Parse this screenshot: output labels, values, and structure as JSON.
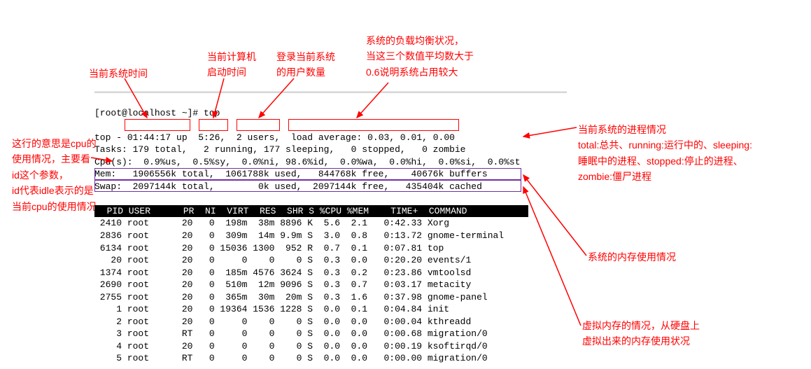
{
  "annotations": {
    "time": "当前系统时间",
    "uptime": "当前计算机\n启动时间",
    "users": "登录当前系统\n的用户数量",
    "load": "系统的负载均衡状况，\n当这三个数值平均数大于\n0.6说明系统占用较大",
    "cpu": "这行的意思是cpu的\n使用情况，主要看\nid这个参数，\nid代表idle表示的是\n当前cpu的使用情况",
    "tasks": "当前系统的进程情况\ntotal:总共、running:运行中的、sleeping:\n睡眠中的进程、stopped:停止的进程、\nzombie:僵尸进程",
    "mem": "系统的内存使用情况",
    "swap": "虚拟内存的情况，从硬盘上\n虚拟出来的内存使用状况"
  },
  "prompt": "[root@localhost ~]# top",
  "summary": {
    "line1_pre": "top - ",
    "time": "01:44:17 up",
    "uptime": "5:26",
    "users": "2 users",
    "load": "load average: 0.03, 0.01, 0.00",
    "tasks": "Tasks: 179 total,   2 running, 177 sleeping,   0 stopped,   0 zombie",
    "cpu": "Cpu(s):  0.9%us,  0.5%sy,  0.0%ni, 98.6%id,  0.0%wa,  0.0%hi,  0.0%si,  0.0%st",
    "mem": "Mem:   1906556k total,  1061788k used,   844768k free,    40676k buffers",
    "swap": "Swap:  2097144k total,        0k used,  2097144k free,   435404k cached"
  },
  "header": "  PID USER      PR  NI  VIRT  RES  SHR S %CPU %MEM    TIME+  COMMAND           ",
  "processes": [
    " 2410 root      20   0  198m  38m 8896 K  5.6  2.1   0:42.33 Xorg",
    " 2836 root      20   0  309m  14m 9.9m S  3.0  0.8   0:13.72 gnome-terminal",
    " 6134 root      20   0 15036 1300  952 R  0.7  0.1   0:07.81 top",
    "   20 root      20   0     0    0    0 S  0.3  0.0   0:20.20 events/1",
    " 1374 root      20   0  185m 4576 3624 S  0.3  0.2   0:23.86 vmtoolsd",
    " 2690 root      20   0  510m  12m 9096 S  0.3  0.7   0:03.17 metacity",
    " 2755 root      20   0  365m  30m  20m S  0.3  1.6   0:37.98 gnome-panel",
    "    1 root      20   0 19364 1536 1228 S  0.0  0.1   0:04.84 init",
    "    2 root      20   0     0    0    0 S  0.0  0.0   0:00.04 kthreadd",
    "    3 root      RT   0     0    0    0 S  0.0  0.0   0:00.68 migration/0",
    "    4 root      20   0     0    0    0 S  0.0  0.0   0:00.19 ksoftirqd/0",
    "    5 root      RT   0     0    0    0 S  0.0  0.0   0:00.00 migration/0"
  ]
}
